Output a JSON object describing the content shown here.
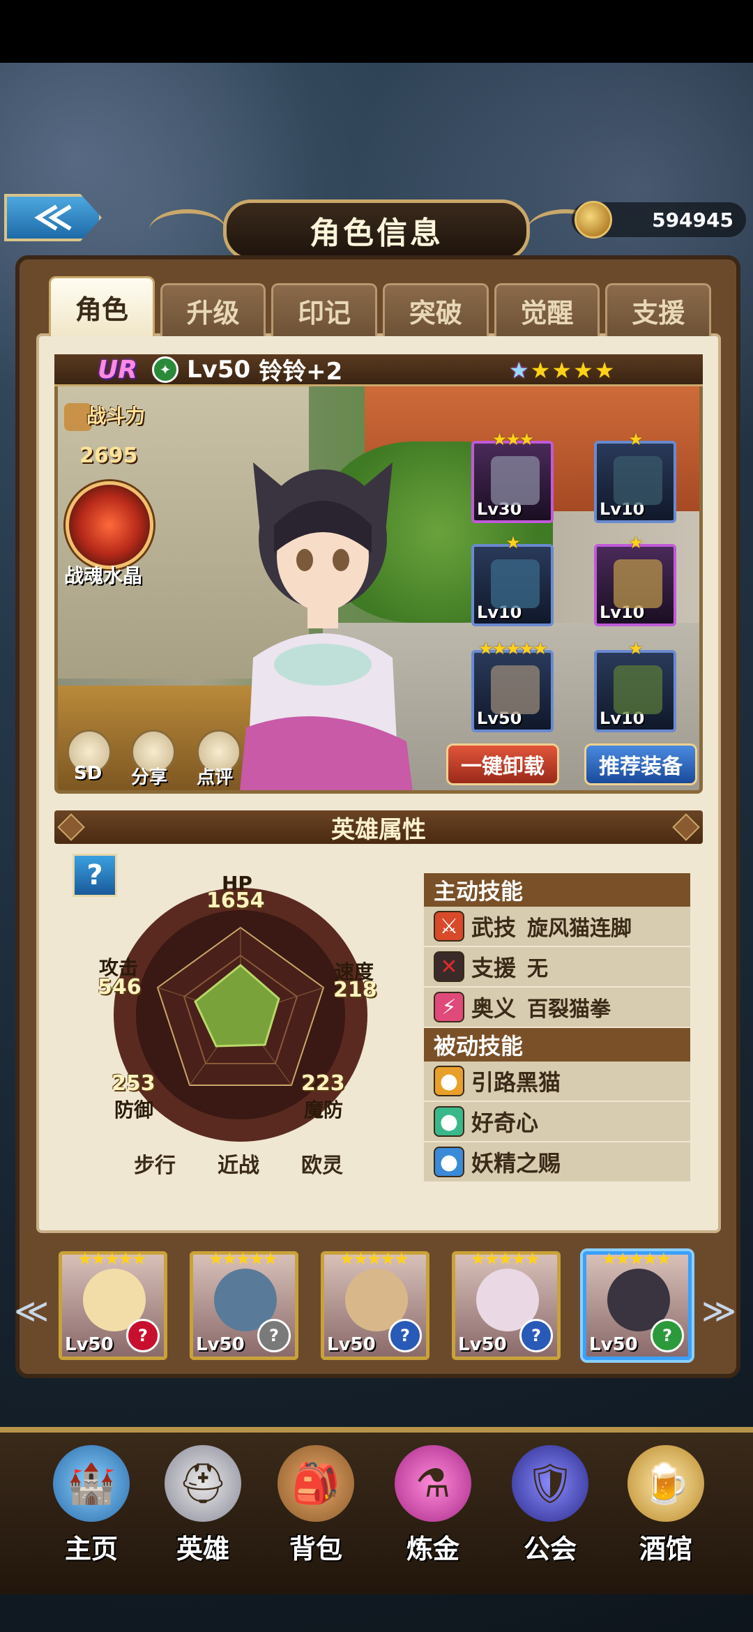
{
  "header": {
    "title": "角色信息",
    "gold": "594945"
  },
  "tabs": [
    {
      "label": "角色",
      "active": true
    },
    {
      "label": "升级"
    },
    {
      "label": "印记"
    },
    {
      "label": "突破"
    },
    {
      "label": "觉醒"
    },
    {
      "label": "支援"
    }
  ],
  "hero": {
    "rarity": "UR",
    "level": "Lv50",
    "name": "铃铃+2",
    "stars": 5,
    "power_label": "战斗力",
    "power": "2695",
    "crystal_label": "战魂水晶",
    "actions": {
      "sd": "SD",
      "share": "分享",
      "review": "点评"
    },
    "unload_label": "一键卸载",
    "recommend_label": "推荐装备"
  },
  "equipment": [
    {
      "level": "Lv30",
      "stars": 3,
      "rarity": "purple"
    },
    {
      "level": "Lv10",
      "stars": 1,
      "rarity": "blue"
    },
    {
      "level": "Lv10",
      "stars": 1,
      "rarity": "blue"
    },
    {
      "level": "Lv10",
      "stars": 1,
      "rarity": "purple"
    },
    {
      "level": "Lv50",
      "stars": 5,
      "rarity": "blue"
    },
    {
      "level": "Lv10",
      "stars": 1,
      "rarity": "blue"
    }
  ],
  "attributes": {
    "title": "英雄属性",
    "help": "?",
    "hp_label": "HP",
    "hp": "1654",
    "atk_label": "攻击",
    "atk": "546",
    "spd_label": "速度",
    "spd": "218",
    "def_label": "防御",
    "def": "253",
    "mdef_label": "魔防",
    "mdef": "223",
    "terrain": [
      "步行",
      "近战",
      "欧灵"
    ]
  },
  "skills": {
    "active_title": "主动技能",
    "active": [
      {
        "type": "武技",
        "name": "旋风猫连脚",
        "color": "#d84a2a"
      },
      {
        "type": "支援",
        "name": "无",
        "color": "#c82a2a"
      },
      {
        "type": "奥义",
        "name": "百裂猫拳",
        "color": "#e04a7a"
      }
    ],
    "passive_title": "被动技能",
    "passive": [
      {
        "name": "引路黑猫",
        "color": "#e8a02a"
      },
      {
        "name": "好奇心",
        "color": "#3ab88a"
      },
      {
        "name": "妖精之赐",
        "color": "#3a8ad8"
      }
    ]
  },
  "team": [
    {
      "level": "Lv50",
      "badge_color": "#c8102e"
    },
    {
      "level": "Lv50",
      "badge_color": "#7a7a7a"
    },
    {
      "level": "Lv50",
      "badge_color": "#2a5ab8"
    },
    {
      "level": "Lv50",
      "badge_color": "#2a5ab8"
    },
    {
      "level": "Lv50",
      "badge_color": "#2a9a3a",
      "selected": true
    }
  ],
  "nav": [
    {
      "label": "主页",
      "icon": "castle-icon"
    },
    {
      "label": "英雄",
      "icon": "helmet-icon"
    },
    {
      "label": "背包",
      "icon": "backpack-icon"
    },
    {
      "label": "炼金",
      "icon": "potion-icon"
    },
    {
      "label": "公会",
      "icon": "shield-icon"
    },
    {
      "label": "酒馆",
      "icon": "beer-icon"
    }
  ]
}
